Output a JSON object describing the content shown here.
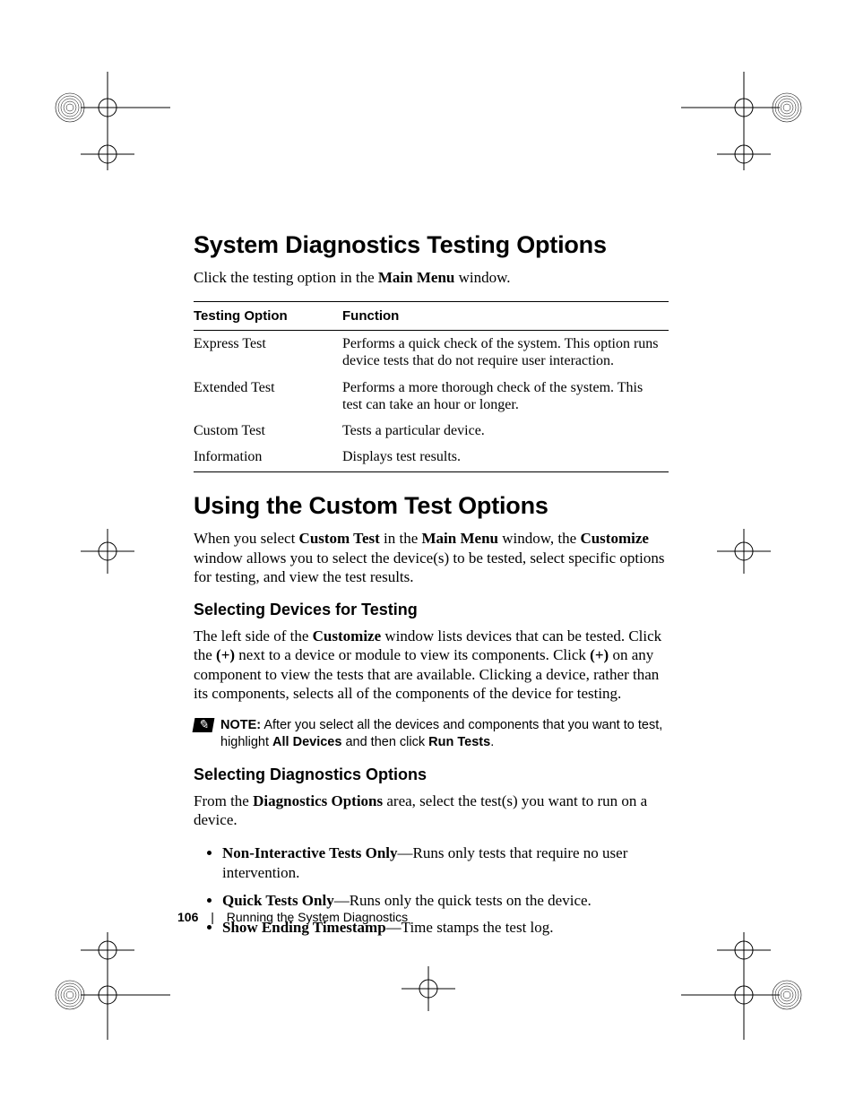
{
  "headings": {
    "h1a": "System Diagnostics Testing Options",
    "h1b": "Using the Custom Test Options",
    "sub1": "Selecting Devices for Testing",
    "sub2": "Selecting Diagnostics Options"
  },
  "intro": {
    "p1_a": "Click the testing option in the ",
    "p1_b": "Main Menu",
    "p1_c": " window."
  },
  "table": {
    "headers": {
      "col1": "Testing Option",
      "col2": "Function"
    },
    "rows": [
      {
        "opt": "Express Test",
        "fn": "Performs a quick check of the system. This option runs device tests that do not require user interaction."
      },
      {
        "opt": "Extended Test",
        "fn": "Performs a more thorough check of the system. This test can take an hour or longer."
      },
      {
        "opt": "Custom Test",
        "fn": "Tests a particular device."
      },
      {
        "opt": "Information",
        "fn": "Displays test results."
      }
    ]
  },
  "custom": {
    "p_a": "When you select ",
    "p_b": "Custom Test",
    "p_c": " in the ",
    "p_d": "Main Menu",
    "p_e": " window, the ",
    "p_f": "Customize",
    "p_g": " window allows you to select the device(s) to be tested, select specific options for testing, and view the test results."
  },
  "selecting": {
    "p_a": "The left side of the ",
    "p_b": "Customize",
    "p_c": " window lists devices that can be tested. Click the ",
    "p_d": "(+)",
    "p_e": " next to a device or module to view its components. Click ",
    "p_f": "(+)",
    "p_g": " on any component to view the tests that are available. Clicking a device, rather than its components, selects all of the components of the device for testing."
  },
  "note": {
    "label": "NOTE:",
    "a": " After you select all the devices and components that you want to test, highlight ",
    "b": "All Devices",
    "c": " and then click ",
    "d": "Run Tests",
    "e": "."
  },
  "diag": {
    "p_a": "From the ",
    "p_b": "Diagnostics Options",
    "p_c": " area, select the test(s) you want to run on a device."
  },
  "bullets": [
    {
      "b": "Non-Interactive Tests Only",
      "t": "—Runs only tests that require no user intervention."
    },
    {
      "b": "Quick Tests Only",
      "t": "—Runs only the quick tests on the device."
    },
    {
      "b": "Show Ending Timestamp",
      "t": "—Time stamps the test log."
    }
  ],
  "footer": {
    "page": "106",
    "title": "Running the System Diagnostics"
  }
}
